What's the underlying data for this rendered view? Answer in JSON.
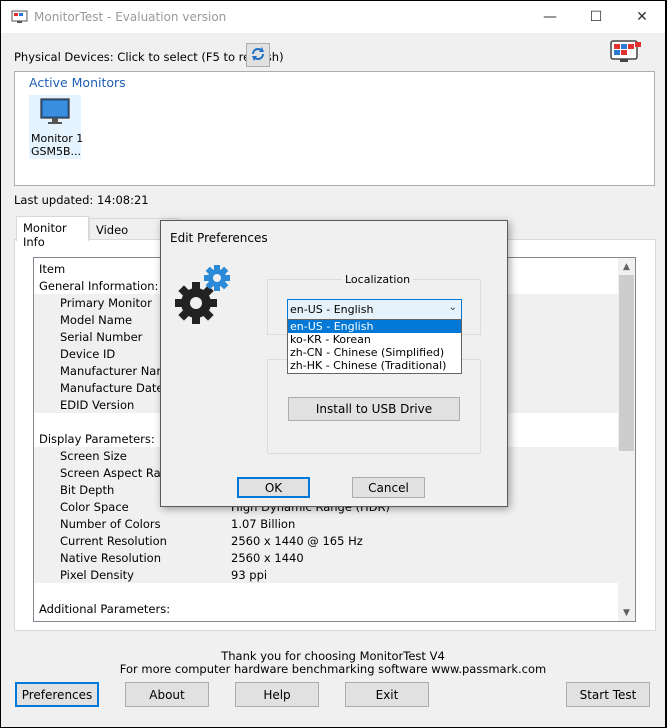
{
  "window": {
    "title": "MonitorTest - Evaluation version",
    "minimize": "—",
    "maximize": "☐",
    "close": "✕"
  },
  "toolbar": {
    "physical_devices_label": "Physical Devices: Click to select (F5 to refresh)",
    "refresh_icon": "refresh-icon",
    "logo_icon": "passmark-logo-icon"
  },
  "monitors": {
    "section_title": "Active Monitors",
    "items": [
      {
        "name": "Monitor 1",
        "model": "GSM5B..."
      }
    ]
  },
  "last_updated": {
    "label": "Last updated: 14:08:21"
  },
  "tabs": [
    {
      "label": "Monitor Info",
      "active": true
    },
    {
      "label": "Video Adapter",
      "active": false
    }
  ],
  "info_table": {
    "header": "Item",
    "rows": [
      {
        "item": "General Information:",
        "value": "",
        "indent": false
      },
      {
        "item": "Primary Monitor",
        "value": "",
        "indent": true
      },
      {
        "item": "Model Name",
        "value": "",
        "indent": true
      },
      {
        "item": "Serial Number",
        "value": "",
        "indent": true
      },
      {
        "item": "Device ID",
        "value": "",
        "indent": true
      },
      {
        "item": "Manufacturer Name",
        "value": "",
        "indent": true
      },
      {
        "item": "Manufacture Date",
        "value": "",
        "indent": true
      },
      {
        "item": "EDID Version",
        "value": "",
        "indent": true
      },
      {
        "item": "",
        "value": "",
        "indent": false
      },
      {
        "item": "Display Parameters:",
        "value": "",
        "indent": false
      },
      {
        "item": "Screen Size",
        "value": "",
        "indent": true
      },
      {
        "item": "Screen Aspect Ratio",
        "value": "",
        "indent": true
      },
      {
        "item": "Bit Depth",
        "value": "",
        "indent": true
      },
      {
        "item": "Color Space",
        "value": "High Dynamic Range (HDR)",
        "indent": true
      },
      {
        "item": "Number of Colors",
        "value": "1.07 Billion",
        "indent": true
      },
      {
        "item": "Current Resolution",
        "value": "2560 x 1440 @ 165 Hz",
        "indent": true
      },
      {
        "item": "Native Resolution",
        "value": "2560 x 1440",
        "indent": true
      },
      {
        "item": "Pixel Density",
        "value": "93 ppi",
        "indent": true
      },
      {
        "item": "",
        "value": "",
        "indent": false
      },
      {
        "item": "Additional Parameters:",
        "value": "",
        "indent": false
      }
    ]
  },
  "footer": {
    "thanks": "Thank you for choosing MonitorTest V4",
    "more_info": "For more computer hardware benchmarking software www.passmark.com",
    "buttons": {
      "preferences": "Preferences",
      "about": "About",
      "help": "Help",
      "exit": "Exit",
      "start_test": "Start Test"
    }
  },
  "dialog": {
    "title": "Edit Preferences",
    "icon": "gears-icon",
    "localization_label": "Localization",
    "language_selected": "en-US - English",
    "language_options": [
      "en-US - English",
      "ko-KR - Korean",
      "zh-CN - Chinese (Simplified)",
      "zh-HK - Chinese (Traditional)"
    ],
    "install_usb": "Install to USB Drive",
    "ok": "OK",
    "cancel": "Cancel"
  }
}
